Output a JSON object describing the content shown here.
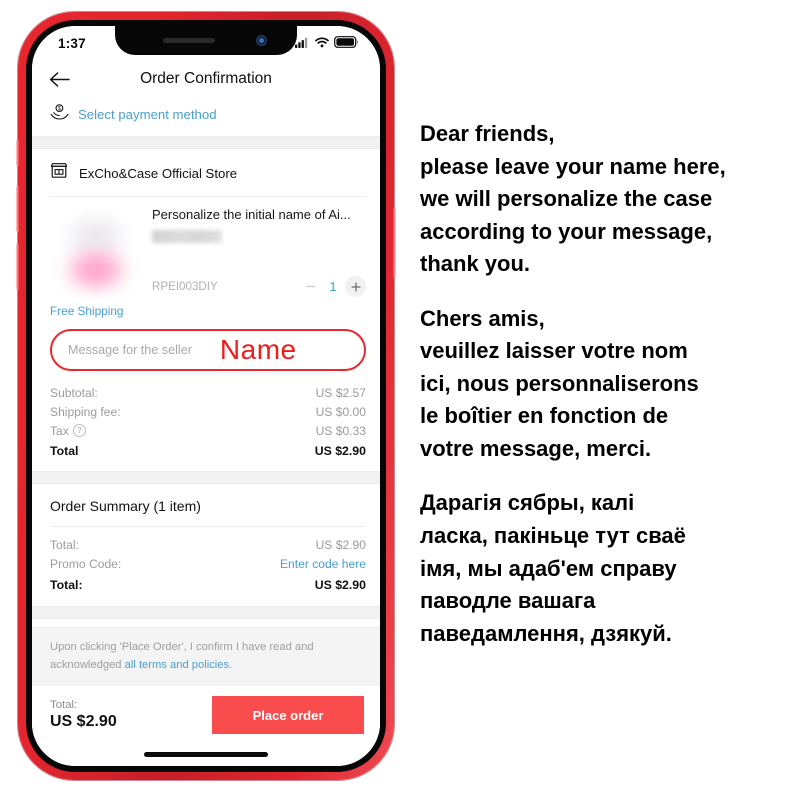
{
  "phone": {
    "status_bar": {
      "time": "1:37",
      "icons": [
        "cellular-signal-icon",
        "wifi-icon",
        "battery-icon"
      ]
    },
    "home_indicator": "home-indicator"
  },
  "nav": {
    "back_icon": "back-arrow-icon",
    "title": "Order Confirmation"
  },
  "payment": {
    "icon": "payment-money-icon",
    "label": "Select payment method"
  },
  "store": {
    "icon": "store-front-icon",
    "name": "ExCho&Case Official Store"
  },
  "product": {
    "title": "Personalize the initial name of Ai...",
    "variant_redacted": "",
    "sku": "RPEI003DIY",
    "quantity": "1",
    "minus_label": "−",
    "plus_label": "+",
    "shipping_note": "Free Shipping"
  },
  "message": {
    "placeholder": "Message for the seller",
    "value": "",
    "annotation": "Name",
    "border_color": "#e8282e",
    "annotation_color": "#ef1c1c"
  },
  "price_breakdown": [
    {
      "label": "Subtotal:",
      "value": "US $2.57",
      "bold": false,
      "has_help": false
    },
    {
      "label": "Shipping fee:",
      "value": "US $0.00",
      "bold": false,
      "has_help": false
    },
    {
      "label": "Tax",
      "value": "US $0.33",
      "bold": false,
      "has_help": true
    },
    {
      "label": "Total",
      "value": "US $2.90",
      "bold": true,
      "has_help": false
    }
  ],
  "order_summary": {
    "title": "Order Summary (1 item)",
    "rows": [
      {
        "label": "Total:",
        "value": "US $2.90",
        "bold": false,
        "link": false
      },
      {
        "label": "Promo Code:",
        "value": "Enter code here",
        "bold": false,
        "link": true
      },
      {
        "label": "Total:",
        "value": "US $2.90",
        "bold": true,
        "link": false
      }
    ]
  },
  "terms": {
    "text_before": "Upon clicking 'Place Order', I confirm I have read and acknowledged ",
    "link_text": "all terms and policies",
    "text_after": "."
  },
  "checkout": {
    "total_label": "Total:",
    "total_value": "US $2.90",
    "button_label": "Place order",
    "button_color": "#f94d4d"
  },
  "note_panel": {
    "english": "Dear friends,\nplease leave your name here,\nwe will personalize the case\naccording to your message,\nthank you.",
    "french": "Chers amis,\nveuillez laisser votre nom\nici, nous personnaliserons\nle boîtier en fonction de\nvotre message, merci.",
    "belarusian": "Дарагія сябры, калі\nласка, пакіньце тут сваё\nімя, мы адаб'ем справу\nпаводле вашага\nпаведамлення, дзякуй."
  }
}
